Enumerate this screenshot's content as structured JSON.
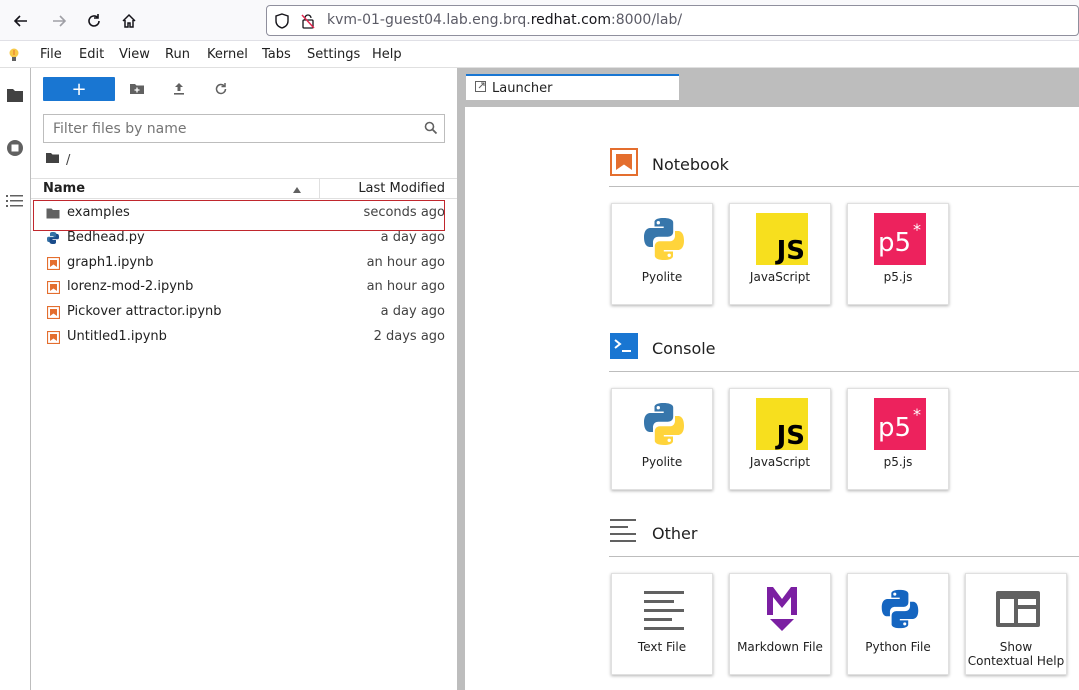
{
  "browser": {
    "url_prefix": "kvm-01-guest04.lab.eng.brq.",
    "url_host": "redhat.com",
    "url_suffix": ":8000/lab/"
  },
  "menu": {
    "items": [
      "File",
      "Edit",
      "View",
      "Run",
      "Kernel",
      "Tabs",
      "Settings",
      "Help"
    ]
  },
  "filebrowser": {
    "new_label": "+",
    "filter_placeholder": "Filter files by name",
    "breadcrumb": "/",
    "col_name": "Name",
    "col_modified": "Last Modified",
    "files": [
      {
        "name": "examples",
        "modified": "seconds ago",
        "icon": "folder-icon"
      },
      {
        "name": "Bedhead.py",
        "modified": "a day ago",
        "icon": "python-file-icon"
      },
      {
        "name": "graph1.ipynb",
        "modified": "an hour ago",
        "icon": "notebook-icon"
      },
      {
        "name": "lorenz-mod-2.ipynb",
        "modified": "an hour ago",
        "icon": "notebook-icon"
      },
      {
        "name": "Pickover attractor.ipynb",
        "modified": "a day ago",
        "icon": "notebook-icon"
      },
      {
        "name": "Untitled1.ipynb",
        "modified": "2 days ago",
        "icon": "notebook-icon"
      }
    ]
  },
  "tabs": {
    "launcher": "Launcher"
  },
  "launcher": {
    "notebook": {
      "title": "Notebook",
      "cards": [
        "Pyolite",
        "JavaScript",
        "p5.js"
      ]
    },
    "console": {
      "title": "Console",
      "cards": [
        "Pyolite",
        "JavaScript",
        "p5.js"
      ]
    },
    "other": {
      "title": "Other",
      "cards": [
        "Text File",
        "Markdown File",
        "Python File",
        "Show Contextual Help"
      ]
    }
  },
  "colors": {
    "accent": "#1976d2",
    "notebook_orange": "#e46e2e",
    "highlight_red": "#c0272d"
  }
}
